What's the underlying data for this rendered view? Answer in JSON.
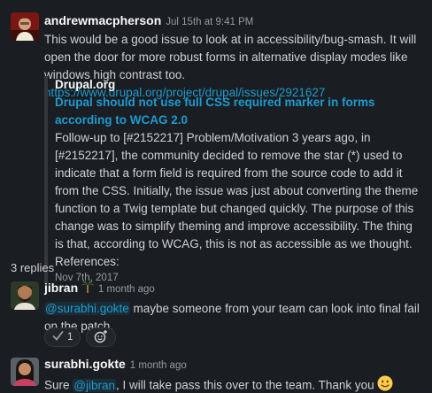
{
  "thread": {
    "parent": {
      "author": "andrewmacpherson",
      "timestamp": "Jul 15th at 9:41 PM",
      "text": "This would be a good issue to look at in accessibility/bug-smash. It will open the door for more robust forms in alternative display modes like windows high contrast too.",
      "link": "https://www.drupal.org/project/drupal/issues/2921627",
      "unfurl": {
        "site": "Drupal.org",
        "title": "Drupal should not use full CSS required marker in forms according to WCAG 2.0",
        "description": "Follow-up to [#2152217] Problem/Motivation 3 years ago, in [#2152217], the community decided to remove the star (*) used to indicate that a form field is required from the source code to add it from the CSS. Initially, the issue was just about converting the theme function to a Twig template but changed quickly. The purpose of this change was to simplify theming and improve accessibility. The thing is that, according to WCAG, this is not as accessible as we thought. References:",
        "date": "Nov 7th, 2017"
      }
    },
    "replies_label": "3 replies",
    "replies": [
      {
        "author": "jibran",
        "status_emoji": "palm-tree",
        "timestamp": "1 month ago",
        "mention": "@surabhi.gokte",
        "text": " maybe someone from your team can look into final fail on the patch.",
        "reactions": [
          {
            "emoji": "check-mark",
            "count": "1"
          }
        ]
      },
      {
        "author": "surabhi.gokte",
        "timestamp": "1 month ago",
        "text_before": "Sure ",
        "mention": "@jibran",
        "text_after": ", I will take pass this over to the team. Thank you ",
        "emoji": "slightly-smiling-face"
      }
    ]
  },
  "colors": {
    "background": "#1a1d21",
    "text": "#d1d2d3",
    "link": "#1d9bd1",
    "muted": "#9a9b9d",
    "unfurl_border": "#35373b"
  }
}
